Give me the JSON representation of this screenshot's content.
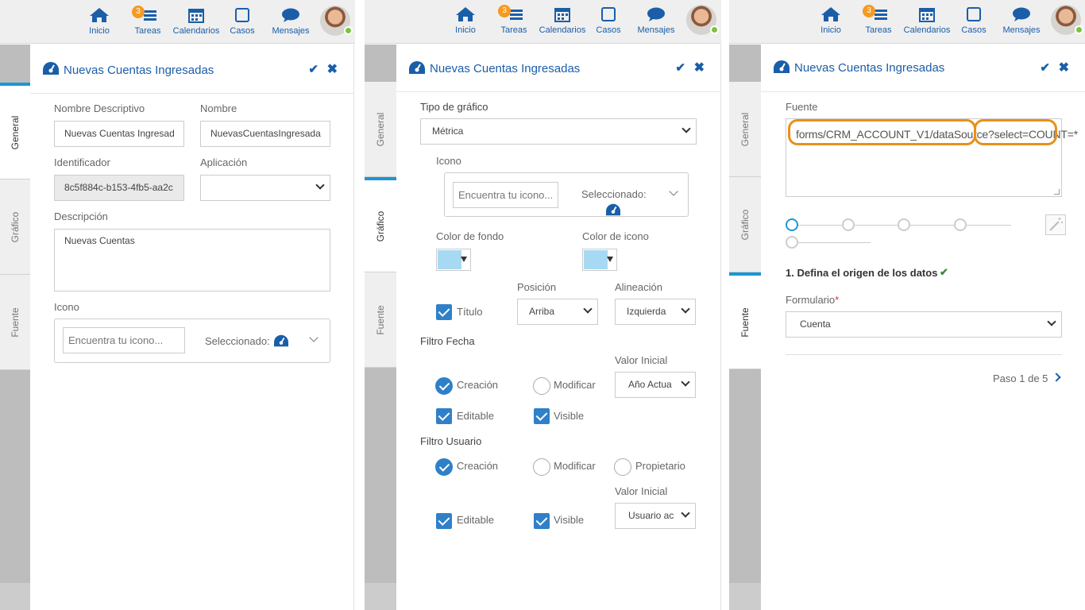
{
  "topbar": {
    "nav": [
      {
        "label": "Inicio",
        "icon": "home-icon"
      },
      {
        "label": "Tareas",
        "icon": "tasks-icon",
        "badge": "3"
      },
      {
        "label": "Calendarios",
        "icon": "calendar-icon"
      },
      {
        "label": "Casos",
        "icon": "cases-icon"
      },
      {
        "label": "Mensajes",
        "icon": "messages-icon"
      }
    ],
    "avatar_icon": "user-avatar",
    "status_color": "#7cc242"
  },
  "colors": {
    "accent": "#1a5ea8",
    "tab_stripe": "#1c96d6",
    "highlight": "#e8901a"
  },
  "tabs": [
    "General",
    "Gráfico",
    "Fuente"
  ],
  "header": {
    "title": "Nuevas Cuentas Ingresadas",
    "confirm_icon": "check-icon",
    "close_icon": "close-icon"
  },
  "general": {
    "descriptive_name_label": "Nombre Descriptivo",
    "descriptive_name_value": "Nuevas Cuentas Ingresad",
    "name_label": "Nombre",
    "name_value": "NuevasCuentasIngresada",
    "identifier_label": "Identificador",
    "identifier_value": "8c5f884c-b153-4fb5-aa2c",
    "application_label": "Aplicación",
    "application_value": "",
    "description_label": "Descripción",
    "description_value": "Nuevas Cuentas",
    "icon_label": "Icono",
    "icon_search_placeholder": "Encuentra tu icono...",
    "selected_label": "Seleccionado:"
  },
  "grafico": {
    "chart_type_label": "Tipo de gráfico",
    "chart_type_value": "Métrica",
    "icon_label": "Icono",
    "icon_search_placeholder": "Encuentra tu icono...",
    "selected_label": "Seleccionado:",
    "bg_color_label": "Color de fondo",
    "icon_color_label": "Color de icono",
    "swatch_color": "#a8d9f3",
    "position_label": "Posición",
    "alignment_label": "Alineación",
    "title_check_label": "Título",
    "position_value": "Arriba",
    "alignment_value": "Izquierda",
    "date_filter_label": "Filtro Fecha",
    "initial_value_label": "Valor Inicial",
    "date_creation": "Creación",
    "date_modify": "Modificar",
    "date_initial_value": "Año Actua",
    "date_editable": "Editable",
    "date_visible": "Visible",
    "user_filter_label": "Filtro Usuario",
    "user_creation": "Creación",
    "user_modify": "Modificar",
    "user_owner": "Propietario",
    "user_initial_value_label": "Valor Inicial",
    "user_initial_value": "Usuario ac",
    "user_editable": "Editable",
    "user_visible": "Visible"
  },
  "fuente": {
    "source_label": "Fuente",
    "source_part1": "forms/CRM_ACCOUNT_V1/dataSource",
    "source_sep": "?",
    "source_part2": "select=COUNT=*",
    "wand_icon": "magic-wand-icon",
    "step_title": "1. Defina el origen de los datos",
    "form_label": "Formulario",
    "required_mark": "*",
    "form_value": "Cuenta",
    "pager": "Paso 1 de 5"
  }
}
